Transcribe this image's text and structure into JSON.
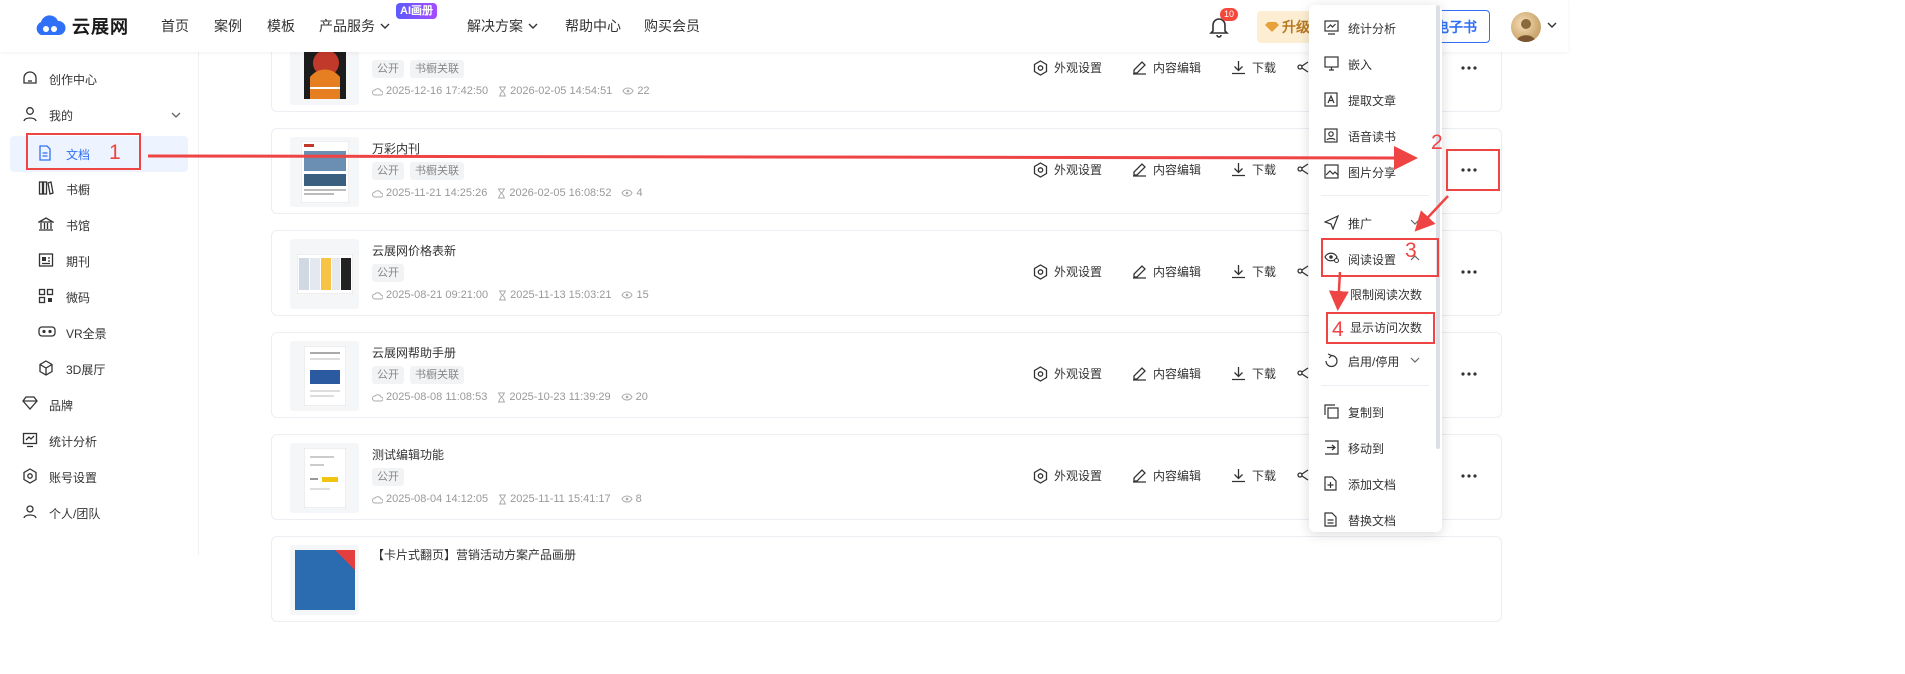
{
  "nav": {
    "logo": "云展网",
    "links": [
      {
        "label": "首页",
        "dropdown": false
      },
      {
        "label": "案例",
        "dropdown": false
      },
      {
        "label": "模板",
        "dropdown": false
      },
      {
        "label": "产品服务",
        "dropdown": true,
        "badge": "AI画册"
      },
      {
        "label": "解决方案",
        "dropdown": true
      },
      {
        "label": "帮助中心",
        "dropdown": false
      },
      {
        "label": "购买会员",
        "dropdown": false
      }
    ],
    "notification_count": "10",
    "upgrade_label": "升级",
    "ebook_label": "电子书"
  },
  "sidebar": {
    "items": [
      {
        "label": "创作中心",
        "icon": "home-icon"
      },
      {
        "label": "我的",
        "icon": "user-icon",
        "expanded": true
      },
      {
        "label": "文档",
        "icon": "document-icon",
        "active": true
      },
      {
        "label": "书橱",
        "icon": "bookshelf-icon"
      },
      {
        "label": "书馆",
        "icon": "library-icon"
      },
      {
        "label": "期刊",
        "icon": "journal-icon"
      },
      {
        "label": "微码",
        "icon": "qrcode-icon"
      },
      {
        "label": "VR全景",
        "icon": "vr-icon"
      },
      {
        "label": "3D展厅",
        "icon": "cube-icon"
      },
      {
        "label": "品牌",
        "icon": "diamond-icon"
      },
      {
        "label": "统计分析",
        "icon": "chart-icon"
      },
      {
        "label": "账号设置",
        "icon": "settings-icon"
      },
      {
        "label": "个人/团队",
        "icon": "team-icon"
      }
    ]
  },
  "documents": [
    {
      "title": "",
      "tags": [
        "公开",
        "书橱关联"
      ],
      "created": "2025-12-16 17:42:50",
      "updated": "2026-02-05 14:54:51",
      "views": "22"
    },
    {
      "title": "万彩内刊",
      "tags": [
        "公开",
        "书橱关联"
      ],
      "created": "2025-11-21 14:25:26",
      "updated": "2026-02-05 16:08:52",
      "views": "4"
    },
    {
      "title": "云展网价格表新",
      "tags": [
        "公开"
      ],
      "created": "2025-08-21 09:21:00",
      "updated": "2025-11-13 15:03:21",
      "views": "15"
    },
    {
      "title": "云展网帮助手册",
      "tags": [
        "公开",
        "书橱关联"
      ],
      "created": "2025-08-08 11:08:53",
      "updated": "2025-10-23 11:39:29",
      "views": "20"
    },
    {
      "title": "测试编辑功能",
      "tags": [
        "公开"
      ],
      "created": "2025-08-04 14:12:05",
      "updated": "2025-11-11 15:41:17",
      "views": "8"
    },
    {
      "title": "【卡片式翻页】营销活动方案产品画册",
      "tags": [],
      "created": "",
      "updated": "",
      "views": ""
    }
  ],
  "actions": {
    "appearance": "外观设置",
    "content_edit": "内容编辑",
    "download": "下载"
  },
  "menu": {
    "items": [
      {
        "label": "统计分析",
        "icon": "chart-icon"
      },
      {
        "label": "嵌入",
        "icon": "embed-icon"
      },
      {
        "label": "提取文章",
        "icon": "extract-icon"
      },
      {
        "label": "语音读书",
        "icon": "voice-icon"
      },
      {
        "label": "图片分享",
        "icon": "image-share-icon"
      },
      {
        "label": "推广",
        "icon": "send-icon",
        "chevron": "down"
      },
      {
        "label": "阅读设置",
        "icon": "eye-settings-icon",
        "chevron": "up"
      },
      {
        "label": "启用/停用",
        "icon": "toggle-icon",
        "chevron": "down"
      },
      {
        "label": "复制到",
        "icon": "copy-icon"
      },
      {
        "label": "移动到",
        "icon": "move-icon"
      },
      {
        "label": "添加文档",
        "icon": "add-doc-icon"
      },
      {
        "label": "替换文档",
        "icon": "replace-icon"
      }
    ],
    "reading_sub": [
      "限制阅读次数",
      "显示访问次数"
    ]
  },
  "annotations": [
    "1",
    "2",
    "3",
    "4"
  ],
  "colors": {
    "accent": "#3070f6",
    "annotation": "#ef4444",
    "upgrade_bg": "#fdeed3",
    "upgrade_text": "#b7791f"
  }
}
